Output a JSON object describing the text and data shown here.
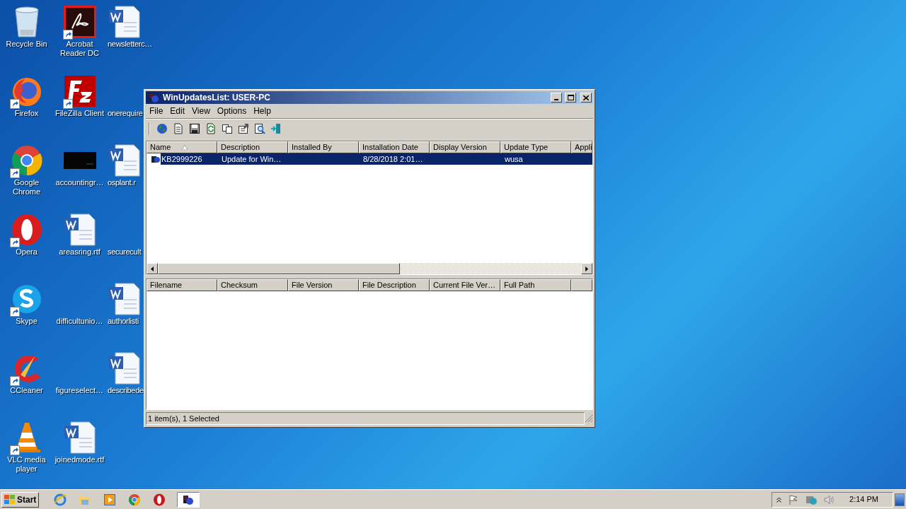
{
  "desktop_icons": [
    {
      "label": "Recycle Bin",
      "kind": "bin",
      "shortcut": false
    },
    {
      "label": "Acrobat Reader DC",
      "kind": "acrobat",
      "shortcut": true
    },
    {
      "label": "newsletterc…",
      "kind": "word",
      "shortcut": false
    },
    {
      "label": "Firefox",
      "kind": "firefox",
      "shortcut": true
    },
    {
      "label": "FileZilla Client",
      "kind": "filezilla",
      "shortcut": true
    },
    {
      "label": "onerequire",
      "kind": "blank",
      "shortcut": false
    },
    {
      "label": "Google Chrome",
      "kind": "chrome",
      "shortcut": true
    },
    {
      "label": "accountingr…",
      "kind": "dark",
      "shortcut": false
    },
    {
      "label": "osplant.r",
      "kind": "word",
      "shortcut": false
    },
    {
      "label": "Opera",
      "kind": "opera",
      "shortcut": true
    },
    {
      "label": "areasring.rtf",
      "kind": "word",
      "shortcut": false
    },
    {
      "label": "securecult",
      "kind": "blank",
      "shortcut": false
    },
    {
      "label": "Skype",
      "kind": "skype",
      "shortcut": true
    },
    {
      "label": "difficultunio…",
      "kind": "blank",
      "shortcut": false
    },
    {
      "label": "authorlisti",
      "kind": "word",
      "shortcut": false
    },
    {
      "label": "CCleaner",
      "kind": "ccleaner",
      "shortcut": true
    },
    {
      "label": "figureselect…",
      "kind": "blank",
      "shortcut": false
    },
    {
      "label": "describede",
      "kind": "word",
      "shortcut": false
    },
    {
      "label": "VLC media player",
      "kind": "vlc",
      "shortcut": true
    },
    {
      "label": "joinedmode.rtf",
      "kind": "word",
      "shortcut": false
    }
  ],
  "window": {
    "title": "WinUpdatesList: USER-PC",
    "menu": [
      "File",
      "Edit",
      "View",
      "Options",
      "Help"
    ],
    "toolbar": [
      {
        "kind": "globe"
      },
      {
        "kind": "document"
      },
      {
        "kind": "save"
      },
      {
        "kind": "refresh"
      },
      {
        "kind": "copy"
      },
      {
        "kind": "properties"
      },
      {
        "kind": "find"
      },
      {
        "kind": "exit"
      }
    ],
    "upper_table": {
      "columns": [
        {
          "label": "Name",
          "sorted": true
        },
        {
          "label": "Description",
          "sorted": false
        },
        {
          "label": "Installed By",
          "sorted": false
        },
        {
          "label": "Installation Date",
          "sorted": false
        },
        {
          "label": "Display Version",
          "sorted": false
        },
        {
          "label": "Update Type",
          "sorted": false
        },
        {
          "label": "Appli",
          "sorted": false
        }
      ],
      "rows": [
        {
          "cells": [
            "KB2999226",
            "Update for Win…",
            null,
            "8/28/2018 2:01…",
            null,
            "wusa"
          ],
          "selected": true
        }
      ]
    },
    "lower_table": {
      "columns": [
        "Filename",
        "Checksum",
        "File Version",
        "File Description",
        "Current File Ver…",
        "Full Path"
      ]
    },
    "status_bar": "1 item(s), 1 Selected"
  },
  "taskbar": {
    "start": "Start",
    "apps": [
      {
        "kind": "ie",
        "selected": false
      },
      {
        "kind": "folder",
        "selected": false
      },
      {
        "kind": "media",
        "selected": false
      },
      {
        "kind": "chrome",
        "selected": false
      },
      {
        "kind": "opera",
        "selected": false
      },
      {
        "kind": "winupdates",
        "selected": true
      }
    ],
    "clock": "2:14 PM"
  }
}
